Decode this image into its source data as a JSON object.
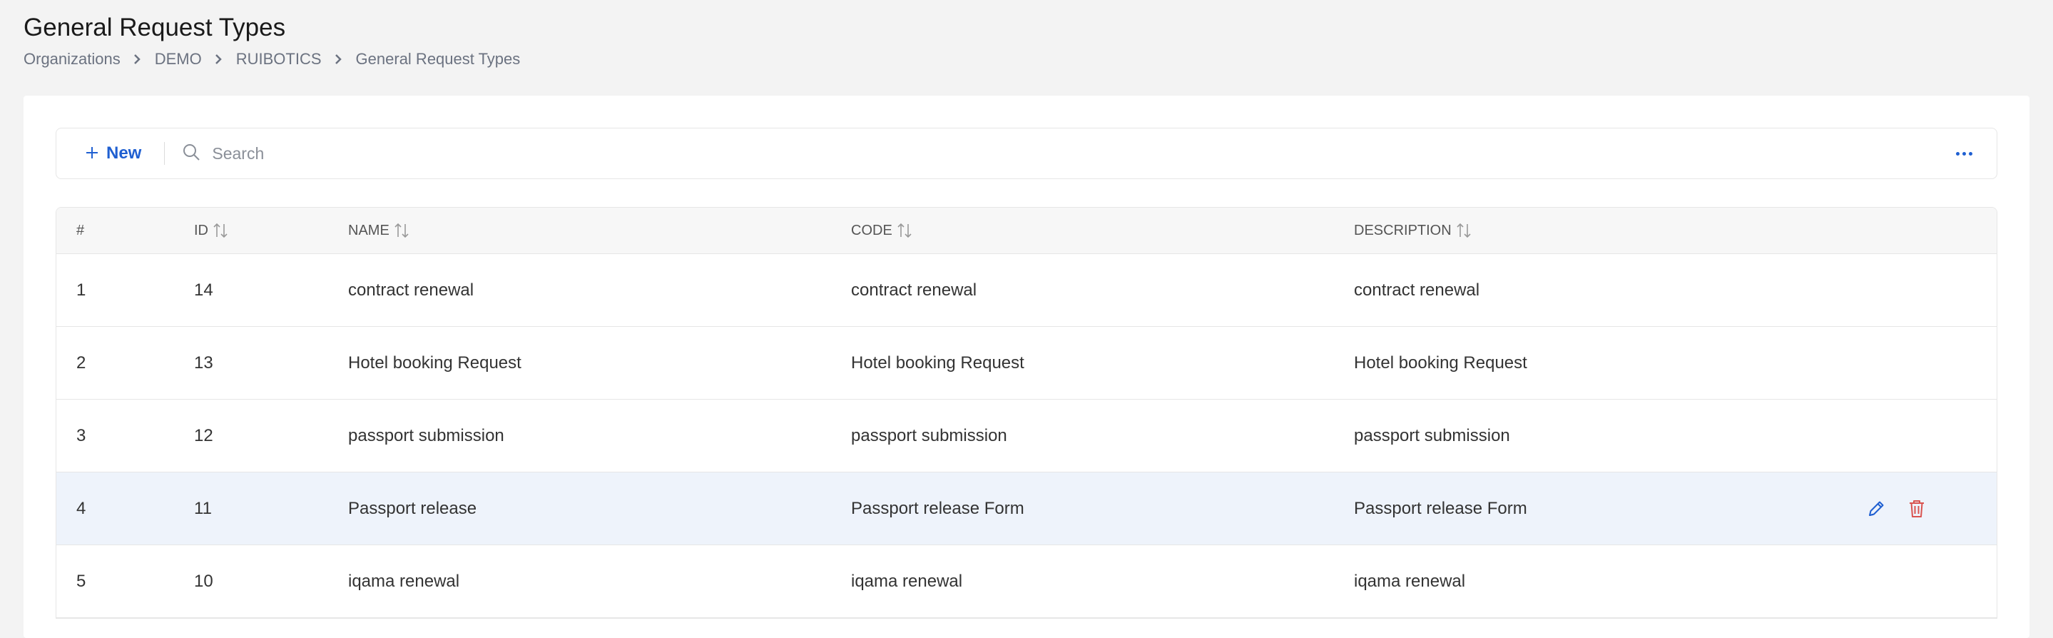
{
  "page": {
    "title": "General Request Types",
    "breadcrumb": [
      "Organizations",
      "DEMO",
      "RUIBOTICS",
      "General Request Types"
    ]
  },
  "toolbar": {
    "new_label": "New",
    "search_placeholder": "Search"
  },
  "table": {
    "headers": {
      "num": "#",
      "id": "ID",
      "name": "NAME",
      "code": "CODE",
      "description": "DESCRIPTION"
    },
    "rows": [
      {
        "num": "1",
        "id": "14",
        "name": "contract renewal",
        "code": "contract renewal",
        "description": "contract renewal"
      },
      {
        "num": "2",
        "id": "13",
        "name": "Hotel booking Request",
        "code": "Hotel booking Request",
        "description": "Hotel booking Request"
      },
      {
        "num": "3",
        "id": "12",
        "name": "passport submission",
        "code": "passport submission",
        "description": "passport submission"
      },
      {
        "num": "4",
        "id": "11",
        "name": "Passport release",
        "code": "Passport release Form",
        "description": "Passport release Form"
      },
      {
        "num": "5",
        "id": "10",
        "name": "iqama renewal",
        "code": "iqama renewal",
        "description": "iqama renewal"
      }
    ]
  },
  "colors": {
    "accent": "#1f5fd1",
    "delete": "#d9534f",
    "row_hover": "#eef3fb"
  },
  "icons": [
    "chevron-right-icon",
    "plus-icon",
    "search-icon",
    "more-icon",
    "sort-icon",
    "edit-icon",
    "trash-icon"
  ]
}
